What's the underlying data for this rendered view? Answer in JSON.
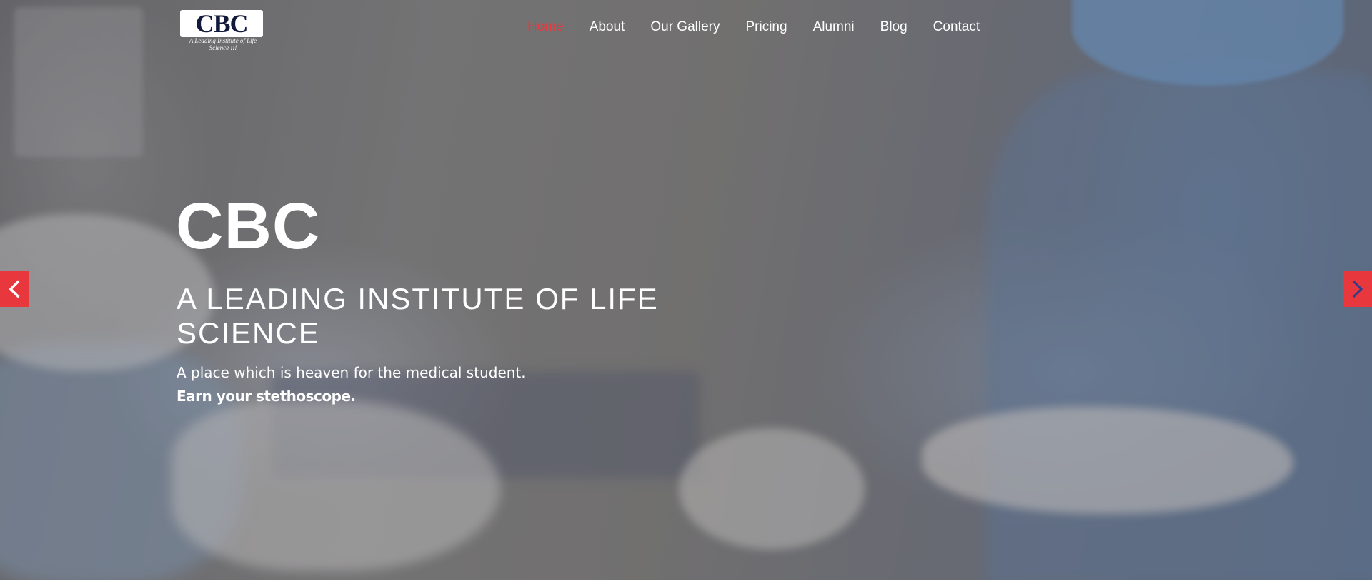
{
  "header": {
    "logo": {
      "text": "CBC",
      "tagline": "A Leading Institute of Life Science !!!"
    },
    "nav": [
      {
        "label": "Home",
        "active": true
      },
      {
        "label": "About",
        "active": false
      },
      {
        "label": "Our Gallery",
        "active": false
      },
      {
        "label": "Pricing",
        "active": false
      },
      {
        "label": "Alumni",
        "active": false
      },
      {
        "label": "Blog",
        "active": false
      },
      {
        "label": "Contact",
        "active": false
      }
    ]
  },
  "hero": {
    "title": "CBC",
    "subtitle": "A LEADING INSTITUTE OF LIFE SCIENCE",
    "description": "A place which is heaven for the medical student.",
    "cta": "Earn your stethoscope."
  },
  "slider": {
    "prev_icon": "chevron-left-icon",
    "next_icon": "chevron-right-icon"
  },
  "colors": {
    "accent": "#e8383d",
    "next_arrow_glyph": "#2a3f8f",
    "text": "#ffffff"
  }
}
